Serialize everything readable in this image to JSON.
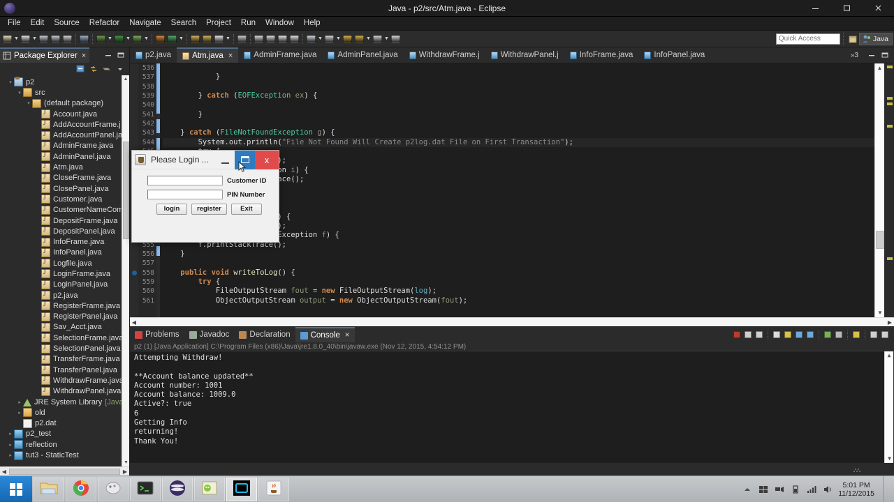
{
  "window": {
    "title": "Java - p2/src/Atm.java - Eclipse",
    "minimize": "minimize",
    "maximize": "maximize",
    "close": "close"
  },
  "menubar": [
    "File",
    "Edit",
    "Source",
    "Refactor",
    "Navigate",
    "Search",
    "Project",
    "Run",
    "Window",
    "Help"
  ],
  "toolbar": {
    "quick_access_placeholder": "Quick Access",
    "perspective_label": "Java",
    "items": [
      {
        "name": "new-wizard-icon",
        "color": "#e8e0c0",
        "caret": true
      },
      {
        "name": "new-java-project-icon",
        "color": "#e4e4e4",
        "caret": true
      },
      {
        "name": "save-icon",
        "color": "#c9cfd6",
        "caret": false
      },
      {
        "name": "save-all-icon",
        "color": "#c9cfd6",
        "caret": false
      },
      {
        "name": "print-icon",
        "color": "#d8d8d8",
        "caret": false
      },
      {
        "name": "skip-breakpoints-icon",
        "color": "#9fb6cc",
        "caret": false
      },
      {
        "name": "debug-icon",
        "color": "#6f9e4e",
        "caret": true
      },
      {
        "name": "run-icon",
        "color": "#3f9b3f",
        "caret": true
      },
      {
        "name": "run-external-tools-icon",
        "color": "#7bb05a",
        "caret": true
      },
      {
        "name": "new-java-class-icon",
        "color": "#d78a3a",
        "caret": false
      },
      {
        "name": "refresh-icon",
        "color": "#4fae6a",
        "caret": true
      },
      {
        "name": "open-type-icon",
        "color": "#d8b45a",
        "caret": false
      },
      {
        "name": "open-task-icon",
        "color": "#d8b45a",
        "caret": false
      },
      {
        "name": "edit-icon",
        "color": "#e8e8e8",
        "caret": true
      },
      {
        "name": "search-icon",
        "color": "#cfcfcf",
        "caret": false
      },
      {
        "name": "previous-annotation-icon",
        "color": "#dcdcdc",
        "caret": false
      },
      {
        "name": "next-annotation-icon",
        "color": "#dcdcdc",
        "caret": false
      },
      {
        "name": "toggle-mark-occurrences-icon",
        "color": "#e4e4e4",
        "caret": false
      },
      {
        "name": "toggle-block-selection-icon",
        "color": "#e4e4e4",
        "caret": false
      },
      {
        "name": "last-edit-location-icon",
        "color": "#cfd6de",
        "caret": true
      },
      {
        "name": "next-edit-icon",
        "color": "#d8d8d8",
        "caret": true
      },
      {
        "name": "back-icon",
        "color": "#d5b04a",
        "caret": false
      },
      {
        "name": "forward-back-icon",
        "color": "#d5b04a",
        "caret": true
      },
      {
        "name": "forward-icon",
        "color": "#d5d5d5",
        "caret": true
      },
      {
        "name": "open-perspective-icon",
        "color": "#d8d8d8",
        "caret": false
      }
    ]
  },
  "package_explorer": {
    "tab_label": "Package Explorer",
    "close_label": "×",
    "view_tools": [
      "collapse-all-icon",
      "link-with-editor-icon",
      "view-menu-icon",
      "view-menu-arrow-icon"
    ],
    "tree": [
      {
        "label": "p2",
        "icon": "project-icon",
        "depth": 0,
        "twisty": "open"
      },
      {
        "label": "src",
        "icon": "source-folder-icon",
        "depth": 1,
        "twisty": "open"
      },
      {
        "label": "(default package)",
        "icon": "package-icon",
        "depth": 2,
        "twisty": "open"
      },
      {
        "label": "Account.java",
        "icon": "java-file-icon",
        "depth": 3,
        "twisty": "none"
      },
      {
        "label": "AddAccountFrame.j",
        "icon": "java-file-icon",
        "depth": 3,
        "twisty": "none"
      },
      {
        "label": "AddAccountPanel.ja",
        "icon": "java-file-icon",
        "depth": 3,
        "twisty": "none"
      },
      {
        "label": "AdminFrame.java",
        "icon": "java-file-icon",
        "depth": 3,
        "twisty": "none"
      },
      {
        "label": "AdminPanel.java",
        "icon": "java-file-icon",
        "depth": 3,
        "twisty": "none"
      },
      {
        "label": "Atm.java",
        "icon": "java-file-icon",
        "depth": 3,
        "twisty": "none"
      },
      {
        "label": "CloseFrame.java",
        "icon": "java-file-icon",
        "depth": 3,
        "twisty": "none"
      },
      {
        "label": "ClosePanel.java",
        "icon": "java-file-icon",
        "depth": 3,
        "twisty": "none"
      },
      {
        "label": "Customer.java",
        "icon": "java-file-icon",
        "depth": 3,
        "twisty": "none"
      },
      {
        "label": "CustomerNameCom",
        "icon": "java-file-icon",
        "depth": 3,
        "twisty": "none"
      },
      {
        "label": "DepositFrame.java",
        "icon": "java-file-icon",
        "depth": 3,
        "twisty": "none"
      },
      {
        "label": "DepositPanel.java",
        "icon": "java-file-icon",
        "depth": 3,
        "twisty": "none"
      },
      {
        "label": "InfoFrame.java",
        "icon": "java-file-icon",
        "depth": 3,
        "twisty": "none"
      },
      {
        "label": "InfoPanel.java",
        "icon": "java-file-icon",
        "depth": 3,
        "twisty": "none"
      },
      {
        "label": "Logfile.java",
        "icon": "java-file-icon",
        "depth": 3,
        "twisty": "none"
      },
      {
        "label": "LoginFrame.java",
        "icon": "java-file-icon",
        "depth": 3,
        "twisty": "none"
      },
      {
        "label": "LoginPanel.java",
        "icon": "java-file-icon",
        "depth": 3,
        "twisty": "none"
      },
      {
        "label": "p2.java",
        "icon": "java-file-icon",
        "depth": 3,
        "twisty": "none"
      },
      {
        "label": "RegisterFrame.java",
        "icon": "java-file-icon",
        "depth": 3,
        "twisty": "none"
      },
      {
        "label": "RegisterPanel.java",
        "icon": "java-file-icon",
        "depth": 3,
        "twisty": "none"
      },
      {
        "label": "Sav_Acct.java",
        "icon": "java-file-icon",
        "depth": 3,
        "twisty": "none"
      },
      {
        "label": "SelectionFrame.java",
        "icon": "java-file-icon",
        "depth": 3,
        "twisty": "none"
      },
      {
        "label": "SelectionPanel.java",
        "icon": "java-file-icon",
        "depth": 3,
        "twisty": "none"
      },
      {
        "label": "TransferFrame.java",
        "icon": "java-file-icon",
        "depth": 3,
        "twisty": "none"
      },
      {
        "label": "TransferPanel.java",
        "icon": "java-file-icon",
        "depth": 3,
        "twisty": "none"
      },
      {
        "label": "WithdrawFrame.java",
        "icon": "java-file-icon",
        "depth": 3,
        "twisty": "none"
      },
      {
        "label": "WithdrawPanel.java",
        "icon": "java-file-icon",
        "depth": 3,
        "twisty": "none"
      },
      {
        "label": "JRE System Library",
        "sublabel": "[JavaS",
        "icon": "jre-library-icon",
        "depth": 1,
        "twisty": "closed"
      },
      {
        "label": "old",
        "icon": "folder-icon",
        "depth": 1,
        "twisty": "closed"
      },
      {
        "label": "p2.dat",
        "icon": "file-icon",
        "depth": 1,
        "twisty": "none"
      },
      {
        "label": "p2_test",
        "icon": "closed-project-icon",
        "depth": 0,
        "twisty": "closed"
      },
      {
        "label": "reflection",
        "icon": "closed-project-icon",
        "depth": 0,
        "twisty": "closed"
      },
      {
        "label": "tut3 - StaticTest",
        "icon": "closed-project-icon",
        "depth": 0,
        "twisty": "closed"
      }
    ]
  },
  "editor": {
    "tabs": [
      {
        "label": "p2.java",
        "active": false,
        "closeable": false
      },
      {
        "label": "Atm.java",
        "active": true,
        "closeable": true
      },
      {
        "label": "AdminFrame.java",
        "active": false,
        "closeable": false
      },
      {
        "label": "AdminPanel.java",
        "active": false,
        "closeable": false
      },
      {
        "label": "WithdrawFrame.j",
        "active": false,
        "closeable": false
      },
      {
        "label": "WithdrawPanel.j",
        "active": false,
        "closeable": false
      },
      {
        "label": "InfoFrame.java",
        "active": false,
        "closeable": false
      },
      {
        "label": "InfoPanel.java",
        "active": false,
        "closeable": false
      }
    ],
    "more_tabs_indicator": "»3",
    "lines": [
      {
        "num": "536",
        "tokens": [
          {
            "t": "",
            "c": "plain"
          }
        ]
      },
      {
        "num": "537",
        "tokens": [
          {
            "t": "            }",
            "c": "plain"
          }
        ]
      },
      {
        "num": "538",
        "tokens": [
          {
            "t": "",
            "c": "plain"
          }
        ]
      },
      {
        "num": "539",
        "tokens": [
          {
            "t": "        } ",
            "c": "plain"
          },
          {
            "t": "catch",
            "c": "kw"
          },
          {
            "t": " (",
            "c": "plain"
          },
          {
            "t": "EOFException",
            "c": "typ"
          },
          {
            "t": " ",
            "c": "plain"
          },
          {
            "t": "ex",
            "c": "var"
          },
          {
            "t": ") {",
            "c": "plain"
          }
        ]
      },
      {
        "num": "540",
        "tokens": [
          {
            "t": "",
            "c": "plain"
          }
        ]
      },
      {
        "num": "541",
        "tokens": [
          {
            "t": "        }",
            "c": "plain"
          }
        ]
      },
      {
        "num": "542",
        "tokens": [
          {
            "t": "",
            "c": "plain"
          }
        ]
      },
      {
        "num": "543",
        "tokens": [
          {
            "t": "    } ",
            "c": "plain"
          },
          {
            "t": "catch",
            "c": "kw"
          },
          {
            "t": " (",
            "c": "plain"
          },
          {
            "t": "FileNotFoundException",
            "c": "typ"
          },
          {
            "t": " ",
            "c": "plain"
          },
          {
            "t": "g",
            "c": "var"
          },
          {
            "t": ") {",
            "c": "plain"
          }
        ]
      },
      {
        "num": "544",
        "tokens": [
          {
            "t": "        System.out.println(",
            "c": "plain"
          },
          {
            "t": "\"File Not Found Will Create p2log.dat File on First Transaction\"",
            "c": "str"
          },
          {
            "t": ");",
            "c": "plain"
          }
        ],
        "current": true
      },
      {
        "num": "545",
        "tokens": [
          {
            "t": "        ",
            "c": "plain"
          },
          {
            "t": "try",
            "c": "kw"
          },
          {
            "t": " {",
            "c": "plain"
          }
        ]
      },
      {
        "num": "546",
        "tokens": [
          {
            "t": "            createNewFile();",
            "c": "plain"
          }
        ]
      },
      {
        "num": "547",
        "tokens": [
          {
            "t": "        } catch (IOException ",
            "c": "plain"
          },
          {
            "t": "i",
            "c": "var"
          },
          {
            "t": ") {",
            "c": "plain"
          }
        ]
      },
      {
        "num": "548",
        "tokens": [
          {
            "t": "            i.printStackTrace();",
            "c": "plain"
          }
        ]
      },
      {
        "num": "549",
        "tokens": [
          {
            "t": "        }",
            "c": "plain"
          }
        ]
      },
      {
        "num": "550",
        "tokens": [
          {
            "t": "",
            "c": "plain"
          }
        ]
      },
      {
        "num": "551",
        "tokens": [
          {
            "t": "",
            "c": "plain"
          }
        ]
      },
      {
        "num": "552",
        "tokens": [
          {
            "t": "    } catch (IOException ",
            "c": "plain"
          },
          {
            "t": "h",
            "c": "var"
          },
          {
            "t": ") {",
            "c": "plain"
          }
        ]
      },
      {
        "num": "553",
        "tokens": [
          {
            "t": "        h.printStackTrace();",
            "c": "plain"
          }
        ]
      },
      {
        "num": "554",
        "tokens": [
          {
            "t": "    } catch (ClassNotFoundException ",
            "c": "plain"
          },
          {
            "t": "f",
            "c": "var"
          },
          {
            "t": ") {",
            "c": "plain"
          }
        ]
      },
      {
        "num": "555",
        "tokens": [
          {
            "t": "        f.printStackTrace();",
            "c": "plain"
          }
        ]
      },
      {
        "num": "556",
        "tokens": [
          {
            "t": "    }",
            "c": "plain"
          }
        ]
      },
      {
        "num": "557",
        "tokens": [
          {
            "t": "",
            "c": "plain"
          }
        ]
      },
      {
        "num": "558",
        "tokens": [
          {
            "t": "    ",
            "c": "plain"
          },
          {
            "t": "public",
            "c": "kw"
          },
          {
            "t": " ",
            "c": "plain"
          },
          {
            "t": "void",
            "c": "kw"
          },
          {
            "t": " ",
            "c": "plain"
          },
          {
            "t": "writeToLog",
            "c": "mth"
          },
          {
            "t": "() {",
            "c": "plain"
          }
        ],
        "marker": true
      },
      {
        "num": "559",
        "tokens": [
          {
            "t": "        ",
            "c": "plain"
          },
          {
            "t": "try",
            "c": "kw"
          },
          {
            "t": " {",
            "c": "plain"
          }
        ]
      },
      {
        "num": "560",
        "tokens": [
          {
            "t": "            FileOutputStream ",
            "c": "plain"
          },
          {
            "t": "fout",
            "c": "var"
          },
          {
            "t": " = ",
            "c": "plain"
          },
          {
            "t": "new",
            "c": "kw"
          },
          {
            "t": " FileOutputStream(",
            "c": "plain"
          },
          {
            "t": "log",
            "c": "fld"
          },
          {
            "t": ");",
            "c": "plain"
          }
        ]
      },
      {
        "num": "561",
        "tokens": [
          {
            "t": "            ObjectOutputStream ",
            "c": "plain"
          },
          {
            "t": "output",
            "c": "var"
          },
          {
            "t": " = ",
            "c": "plain"
          },
          {
            "t": "new",
            "c": "kw"
          },
          {
            "t": " ObjectOutputStream(",
            "c": "plain"
          },
          {
            "t": "fout",
            "c": "var"
          },
          {
            "t": ");",
            "c": "plain"
          }
        ]
      }
    ]
  },
  "bottom_panel": {
    "tabs": [
      {
        "label": "Problems",
        "active": false,
        "icon": "problems-icon",
        "closeable": false
      },
      {
        "label": "Javadoc",
        "active": false,
        "icon": "javadoc-icon",
        "closeable": false
      },
      {
        "label": "Declaration",
        "active": false,
        "icon": "declaration-icon",
        "closeable": false
      },
      {
        "label": "Console",
        "active": true,
        "icon": "console-icon",
        "closeable": true
      }
    ],
    "tools": [
      {
        "name": "terminate-icon",
        "color": "#c0392b"
      },
      {
        "name": "remove-launch-icon",
        "color": "#cfcfcf"
      },
      {
        "name": "remove-all-terminated-icon",
        "color": "#cfcfcf"
      },
      {
        "name": "clear-console-icon",
        "color": "#dcdcdc"
      },
      {
        "name": "show-console-on-output-icon",
        "color": "#d8c04a"
      },
      {
        "name": "scroll-lock-icon",
        "color": "#6fa8dc"
      },
      {
        "name": "word-wrap-icon",
        "color": "#6fa8dc"
      },
      {
        "name": "pin-console-icon",
        "color": "#7bb05a"
      },
      {
        "name": "display-selected-console-icon",
        "color": "#b9b9b9"
      },
      {
        "name": "open-console-icon",
        "color": "#d8c04a"
      },
      {
        "name": "minimize-icon",
        "color": "#cfcfcf"
      },
      {
        "name": "maximize-icon",
        "color": "#cfcfcf"
      }
    ],
    "console_header": "p2 (1) [Java Application] C:\\Program Files (x86)\\Java\\jre1.8.0_40\\bin\\javaw.exe (Nov 12, 2015, 4:54:12 PM)",
    "console_lines": [
      "Attempting Withdraw!",
      "",
      "**Account balance updated**",
      "Account number: 1001",
      "Account balance: 1009.0",
      "Active?: true",
      "6",
      "Getting Info",
      "returning!",
      "Thank You!"
    ]
  },
  "login_dialog": {
    "title": "Please Login ...",
    "minimize_label": "minimize",
    "maximize_label": "restore",
    "close_label": "x",
    "fields": [
      {
        "label": "Customer ID",
        "value": "",
        "name": "customer-id-field"
      },
      {
        "label": "PIN Number",
        "value": "",
        "name": "pin-number-field"
      }
    ],
    "buttons": [
      "login",
      "register",
      "Exit"
    ]
  },
  "taskbar": {
    "start_label": "Start",
    "items": [
      {
        "name": "file-explorer-icon",
        "active": false
      },
      {
        "name": "google-chrome-icon",
        "active": false
      },
      {
        "name": "paint-icon",
        "active": false
      },
      {
        "name": "command-prompt-icon",
        "active": false
      },
      {
        "name": "eclipse-icon",
        "active": false
      },
      {
        "name": "notepad-icon",
        "active": false
      },
      {
        "name": "terminal-window-icon",
        "active": true
      },
      {
        "name": "java-app-icon",
        "active": false
      }
    ],
    "tray": [
      "show-hidden-icons",
      "windows-security-icon",
      "network-icon",
      "battery-icon",
      "signal-icon",
      "volume-icon"
    ],
    "clock_time": "5:01 PM",
    "clock_date": "11/12/2015"
  }
}
